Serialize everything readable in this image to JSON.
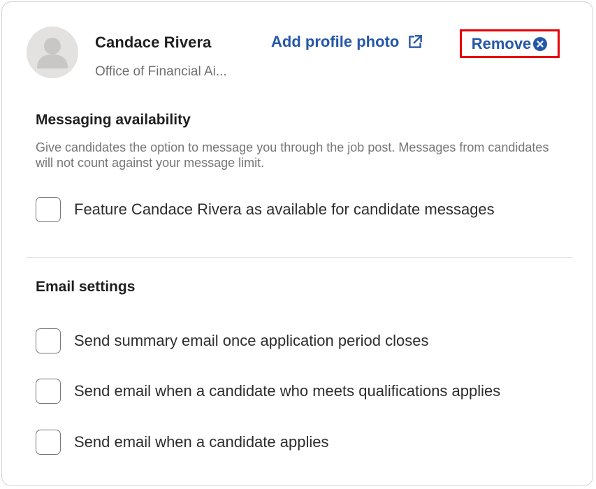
{
  "profile": {
    "name": "Candace Rivera",
    "organization": "Office of Financial Ai...",
    "avatar_icon": "person-placeholder-icon",
    "add_photo_label": "Add profile photo",
    "add_photo_icon": "external-link-icon",
    "remove_label": "Remove",
    "remove_icon": "close-circle-icon"
  },
  "messaging": {
    "title": "Messaging availability",
    "description": "Give candidates the option to message you through the job post. Messages from candidates will not count against your message limit.",
    "option": {
      "label": "Feature Candace Rivera as available for candidate messages",
      "checked": false
    }
  },
  "email": {
    "title": "Email settings",
    "options": [
      {
        "label": "Send summary email once application period closes",
        "checked": false
      },
      {
        "label": "Send email when a candidate who meets qualifications applies",
        "checked": false
      },
      {
        "label": "Send email when a candidate applies",
        "checked": false
      }
    ]
  },
  "colors": {
    "link": "#2557a7",
    "highlight_border": "#e60000",
    "muted_text": "#767676"
  }
}
